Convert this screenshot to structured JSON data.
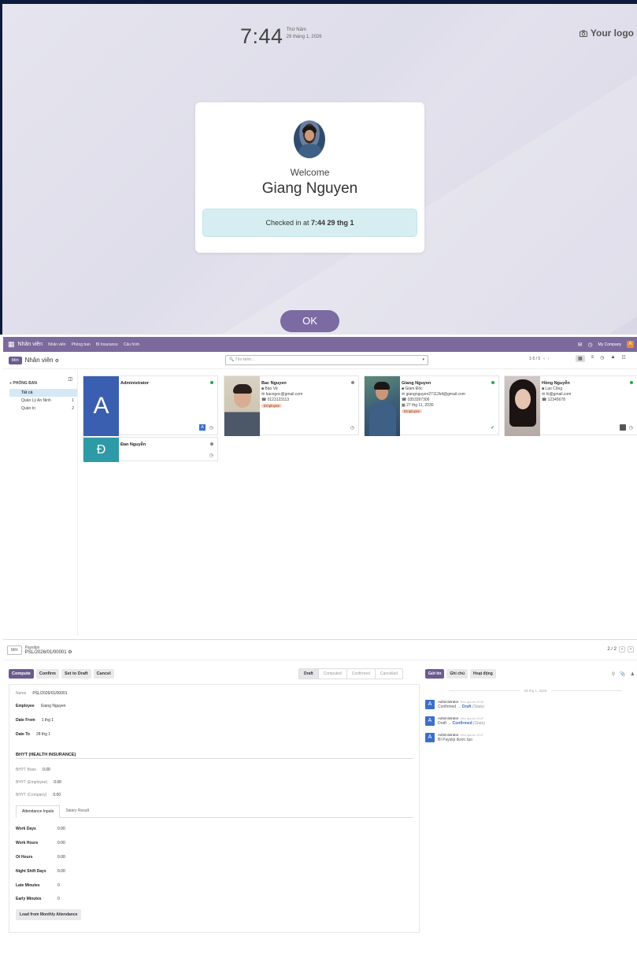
{
  "kiosk": {
    "time": "7:44",
    "weekday": "Thứ Năm",
    "date": "29 tháng 1, 2026",
    "logo_icon": "camera-icon",
    "logo_text": "Your logo",
    "welcome": "Welcome",
    "name": "Giang Nguyen",
    "checkin_prefix": "Checked in at",
    "checkin_time": "7:44 29 thg 1",
    "ok": "OK"
  },
  "employees": {
    "topbar": {
      "app_title": "Nhân viên",
      "menus": [
        "Nhân viên",
        "Phòng ban",
        "BI Insurance",
        "Cấu hình"
      ],
      "company": "My Company",
      "user_initial": "A"
    },
    "new_label": "Mới",
    "title": "Nhân viên",
    "search_placeholder": "Tìm kiếm...",
    "pager": "1-5 / 5",
    "side": {
      "heading": "PHÒNG BAN",
      "items": [
        {
          "label": "Tất cả",
          "count": ""
        },
        {
          "label": "Quản Lý An Ninh",
          "count": "1"
        },
        {
          "label": "Quản trị",
          "count": "2"
        }
      ]
    },
    "cards": [
      {
        "name": "Administrator",
        "initial": "A",
        "status_color": "#28a745"
      },
      {
        "name": "Bac Nguyen",
        "job": "Bảo Vệ",
        "email": "bacngoc@gmail.com",
        "phone": "0123123113",
        "tag": "Employee",
        "status_color": "#888888"
      },
      {
        "name": "Giang Nguyen",
        "job": "Giám Đốc",
        "email": "giangnguyen27112k4@gmail.com",
        "phone": "0353397306",
        "date": "27 thg 11, 2030",
        "tag": "Employee",
        "status_color": "#28a745"
      },
      {
        "name": "Hồng Nguyễn",
        "job": "Lao Công",
        "email": "hi@gmail.com",
        "phone": "12345678",
        "status_color": "#28a745"
      },
      {
        "name": "Đan Nguyễn",
        "initial": "Đ",
        "status_color": "#888888"
      }
    ]
  },
  "payslip": {
    "new_label": "Mới",
    "breadcrumb": "Payslips",
    "record": "PSL/2026/01/00001",
    "pager": "2 / 2",
    "actions": [
      "Compute",
      "Confirm",
      "Set to Draft",
      "Cancel"
    ],
    "statuses": [
      "Draft",
      "Computed",
      "Confirmed",
      "Cancelled"
    ],
    "active_status": "Draft",
    "fields": {
      "name_label": "Name",
      "name_value": "PSL/2026/01/00001",
      "employee_label": "Employee",
      "employee_value": "Giang Nguyen",
      "date_from_label": "Date From",
      "date_from_value": "1 thg 1",
      "date_to_label": "Date To",
      "date_to_value": "28 thg 1"
    },
    "bhyt_title": "BHYT (HEALTH INSURANCE)",
    "bhyt": [
      {
        "label": "BHYT Base",
        "value": "0.00"
      },
      {
        "label": "BHYT (Employee)",
        "value": "0.00"
      },
      {
        "label": "BHYT (Company)",
        "value": "0.00"
      }
    ],
    "tabs": [
      "Attendance Inputs",
      "Salary Result"
    ],
    "attendance": [
      {
        "label": "Work Days",
        "value": "0.00"
      },
      {
        "label": "Work Hours",
        "value": "0.00"
      },
      {
        "label": "Ot Hours",
        "value": "0.00"
      },
      {
        "label": "Night Shift Days",
        "value": "0.00"
      },
      {
        "label": "Late Minutes",
        "value": "0"
      },
      {
        "label": "Early Minutes",
        "value": "0"
      }
    ],
    "load_button": "Load from Monthly Attendance",
    "chatter": {
      "buttons": [
        "Gửi tin",
        "Ghi chú",
        "Hoạt động"
      ],
      "date": "29 thg 1, 2026",
      "messages": [
        {
          "author": "Administrator",
          "when": "Hôm qua lúc 20:49",
          "from": "Confirmed",
          "to": "Draft",
          "field": "(State)"
        },
        {
          "author": "Administrator",
          "when": "Hôm qua lúc 20:47",
          "from": "Draft",
          "to": "Confirmed",
          "field": "(State)"
        },
        {
          "author": "Administrator",
          "when": "Hôm qua lúc 20:47",
          "text": "BI Payslip được tạo"
        }
      ]
    }
  }
}
